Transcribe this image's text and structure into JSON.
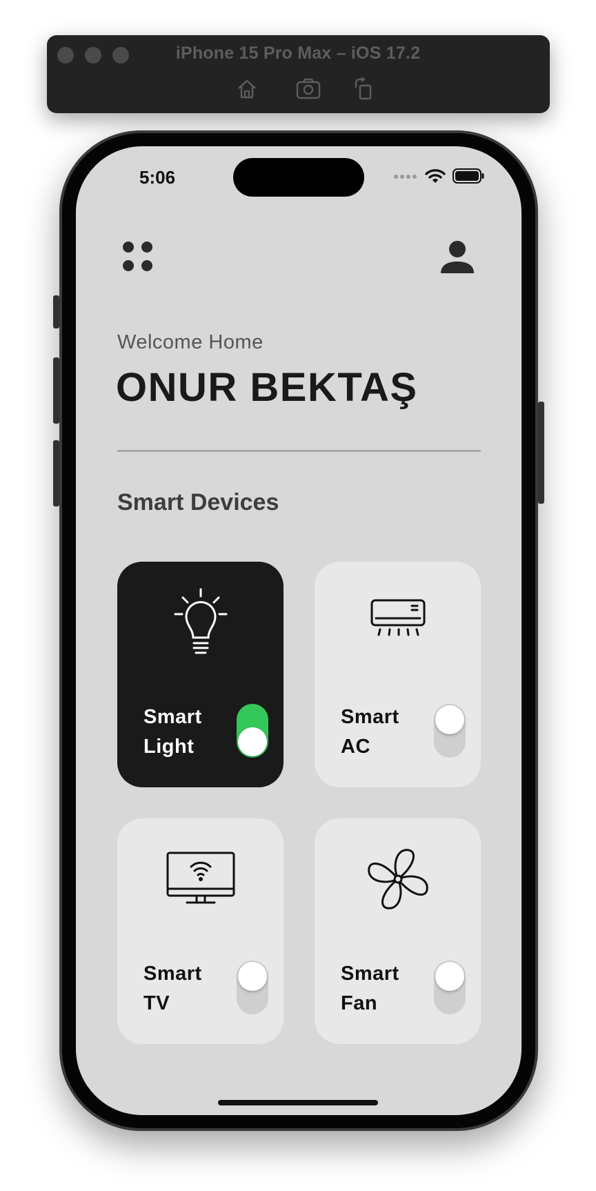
{
  "simulator": {
    "title": "iPhone 15 Pro Max – iOS 17.2",
    "tools": [
      {
        "icon": "home-icon"
      },
      {
        "icon": "screenshot-icon"
      },
      {
        "icon": "rotate-icon"
      }
    ]
  },
  "status_bar": {
    "time": "5:06",
    "icons": [
      "cellular-icon",
      "wifi-icon",
      "battery-icon"
    ]
  },
  "header": {
    "menu_icon": "menu-dots-icon",
    "profile_icon": "person-icon"
  },
  "greeting": {
    "welcome": "Welcome Home",
    "name": "ONUR BEKTAŞ"
  },
  "section": {
    "title": "Smart Devices"
  },
  "devices": [
    {
      "line1": "Smart",
      "line2": "Light",
      "icon": "light-bulb-icon",
      "on": true
    },
    {
      "line1": "Smart",
      "line2": "AC",
      "icon": "air-conditioner-icon",
      "on": false
    },
    {
      "line1": "Smart",
      "line2": "TV",
      "icon": "smart-tv-icon",
      "on": false
    },
    {
      "line1": "Smart",
      "line2": "Fan",
      "icon": "fan-icon",
      "on": false
    }
  ],
  "colors": {
    "screen_bg": "#d8d8d8",
    "card_active": "#1a1a1a",
    "card_inactive": "#e8e8e8",
    "switch_on": "#34c759",
    "switch_off": "#cfcfcf"
  }
}
